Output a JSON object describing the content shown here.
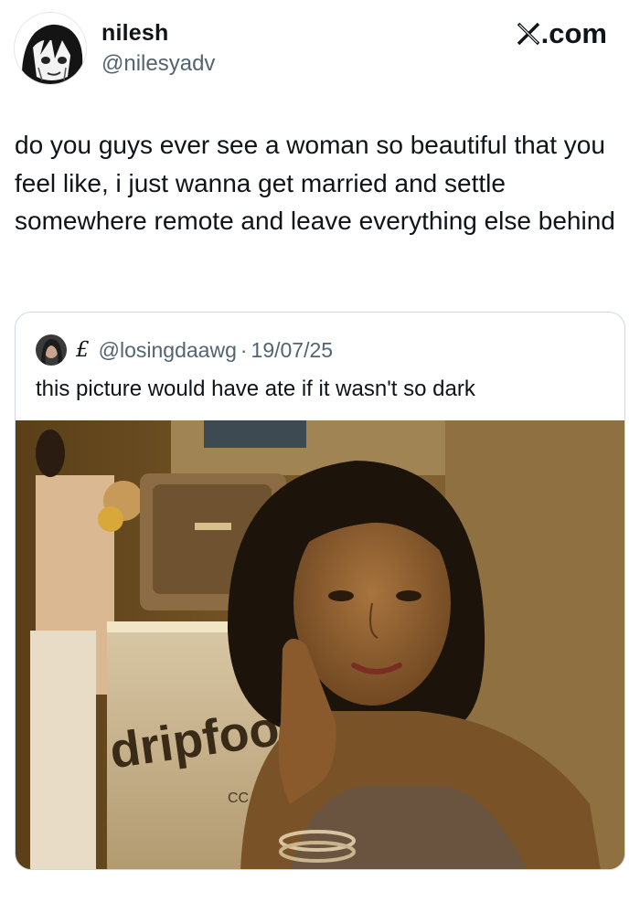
{
  "tweet": {
    "author_name": "nilesh",
    "author_handle": "@nilesyadv",
    "brand": ".com",
    "brand_icon": "x-logo-icon",
    "text": "do you guys ever see a woman so beautiful that you feel like, i just wanna get married and settle somewhere remote and leave everything else behind"
  },
  "quote": {
    "flag": "£",
    "handle": "@losingdaawg",
    "separator": "·",
    "date": "19/07/25",
    "text": "this picture would have ate if it wasn't so dark",
    "image_sign_text": "dripfoo",
    "image_small_text": "CC"
  },
  "colors": {
    "text_primary": "#0f1419",
    "text_secondary": "#536471",
    "border": "#cfd9de",
    "photo_warm": "#6b4a1e"
  }
}
